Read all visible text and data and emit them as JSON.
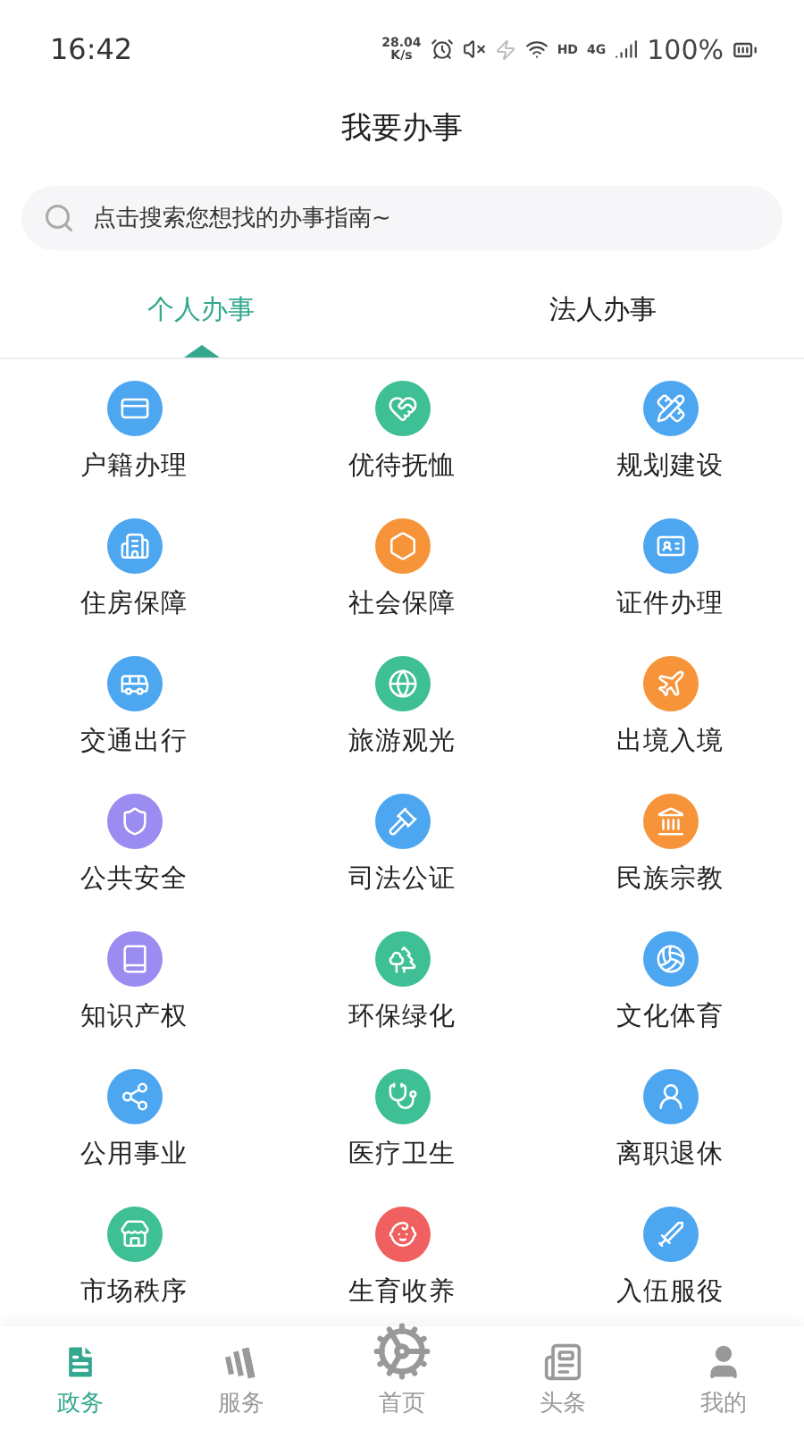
{
  "status_bar": {
    "time": "16:42",
    "speed_value": "28.04",
    "speed_unit": "K/s",
    "hd": "HD",
    "network": "4G",
    "battery": "100%"
  },
  "header": {
    "title": "我要办事"
  },
  "search": {
    "placeholder": "点击搜索您想找的办事指南~"
  },
  "tabs": [
    {
      "label": "个人办事",
      "selected": true
    },
    {
      "label": "法人办事",
      "selected": false
    }
  ],
  "services": [
    {
      "label": "户籍办理",
      "color": "#4da6f0"
    },
    {
      "label": "优待抚恤",
      "color": "#3fbf95"
    },
    {
      "label": "规划建设",
      "color": "#4da6f0"
    },
    {
      "label": "住房保障",
      "color": "#4da6f0"
    },
    {
      "label": "社会保障",
      "color": "#f7943a"
    },
    {
      "label": "证件办理",
      "color": "#4da6f0"
    },
    {
      "label": "交通出行",
      "color": "#4da6f0"
    },
    {
      "label": "旅游观光",
      "color": "#3fbf95"
    },
    {
      "label": "出境入境",
      "color": "#f7943a"
    },
    {
      "label": "公共安全",
      "color": "#9a8cf0"
    },
    {
      "label": "司法公证",
      "color": "#4da6f0"
    },
    {
      "label": "民族宗教",
      "color": "#f7943a"
    },
    {
      "label": "知识产权",
      "color": "#9a8cf0"
    },
    {
      "label": "环保绿化",
      "color": "#3fbf95"
    },
    {
      "label": "文化体育",
      "color": "#4da6f0"
    },
    {
      "label": "公用事业",
      "color": "#4da6f0"
    },
    {
      "label": "医疗卫生",
      "color": "#3fbf95"
    },
    {
      "label": "离职退休",
      "color": "#4da6f0"
    },
    {
      "label": "市场秩序",
      "color": "#3fbf95"
    },
    {
      "label": "生育收养",
      "color": "#f06060"
    },
    {
      "label": "入伍服役",
      "color": "#4da6f0"
    }
  ],
  "bottom_nav": [
    {
      "label": "政务",
      "kind": "tab",
      "selected": true
    },
    {
      "label": "服务",
      "kind": "tab",
      "selected": false
    },
    {
      "label": "首页",
      "kind": "center",
      "selected": false
    },
    {
      "label": "头条",
      "kind": "tab",
      "selected": false
    },
    {
      "label": "我的",
      "kind": "tab",
      "selected": false
    }
  ]
}
